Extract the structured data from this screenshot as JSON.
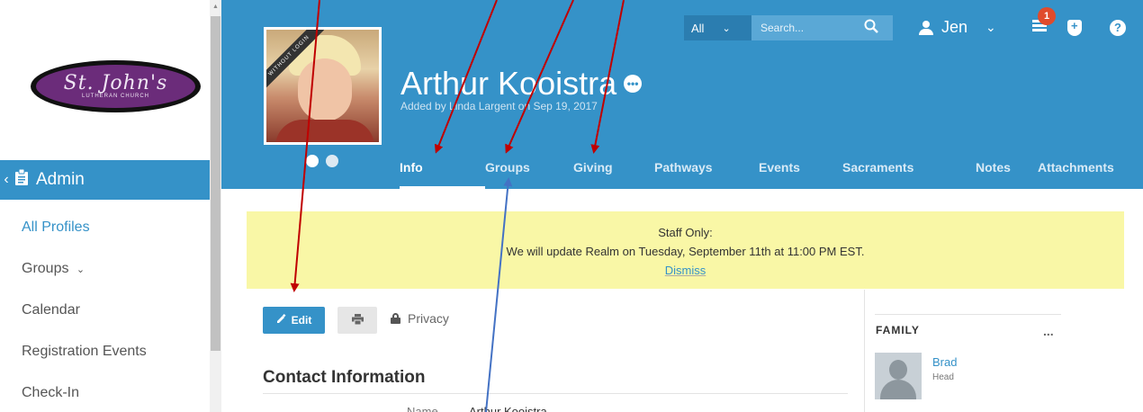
{
  "sidebar": {
    "logo": {
      "script": "St. John's",
      "sub": "LUTHERAN CHURCH"
    },
    "admin_label": "Admin",
    "items": [
      {
        "label": "All Profiles",
        "active": true
      },
      {
        "label": "Groups",
        "has_chevron": true
      },
      {
        "label": "Calendar"
      },
      {
        "label": "Registration Events"
      },
      {
        "label": "Check-In"
      }
    ]
  },
  "header": {
    "photo_ribbon": "WITHOUT LOGIN",
    "name": "Arthur Kooistra",
    "added_by": "Added by Linda Largent on Sep 19, 2017",
    "tabs": [
      {
        "label": "Info",
        "active": true
      },
      {
        "label": "Groups"
      },
      {
        "label": "Giving"
      },
      {
        "label": "Pathways"
      },
      {
        "label": "Events"
      },
      {
        "label": "Sacraments"
      },
      {
        "label": "Notes"
      },
      {
        "label": "Attachments"
      }
    ],
    "search": {
      "scope": "All",
      "placeholder": "Search..."
    },
    "user": {
      "name": "Jen"
    },
    "notification_count": "1"
  },
  "notice": {
    "title": "Staff Only:",
    "message": "We will update Realm on Tuesday, September 11th at 11:00 PM EST.",
    "dismiss": "Dismiss"
  },
  "actions": {
    "edit": "Edit",
    "privacy": "Privacy"
  },
  "contact": {
    "title": "Contact Information",
    "name_label": "Name",
    "name_value": "Arthur Kooistra"
  },
  "family": {
    "title": "FAMILY",
    "more": "...",
    "members": [
      {
        "name": "Brad",
        "role": "Head"
      }
    ]
  },
  "colors": {
    "accent": "#3592c8",
    "notice_bg": "#f9f7a6",
    "badge": "#e04b2c",
    "arrow_red": "#c00000",
    "arrow_blue": "#4472c4"
  }
}
